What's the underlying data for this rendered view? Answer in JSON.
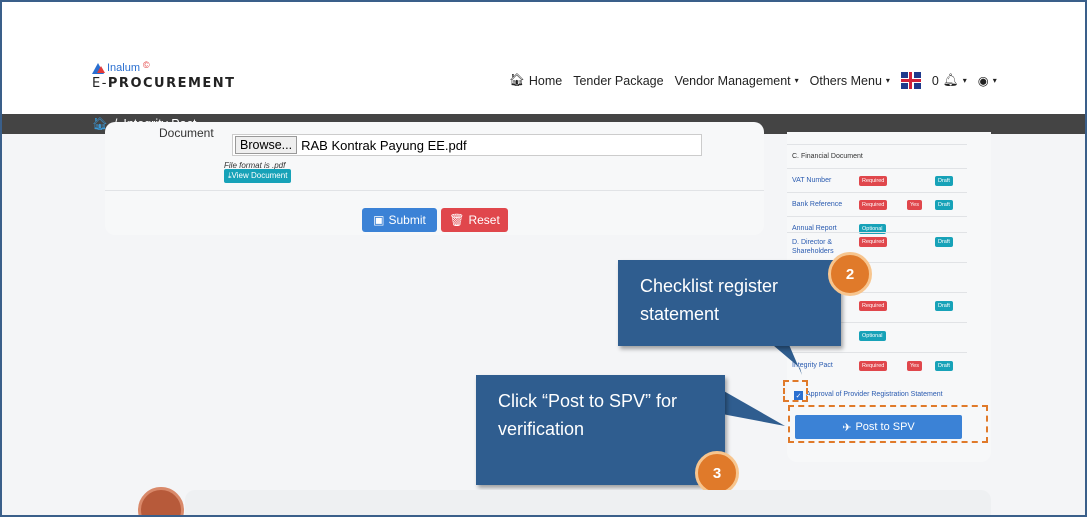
{
  "brand": {
    "logo_top": "Inalum",
    "logo_sup": "©",
    "logo_prefix": "E-",
    "logo_main": "PROCUREMENT"
  },
  "nav": {
    "home": "Home",
    "tender": "Tender Package",
    "vendor": "Vendor Management",
    "others": "Others Menu",
    "notif_count": "0"
  },
  "breadcrumb": {
    "sep": "/",
    "current": "Integrity Pact"
  },
  "form": {
    "document_label": "Document",
    "browse_label": "Browse...",
    "file_name": "RAB Kontrak Payung EE.pdf",
    "file_format": "File format is .pdf",
    "view_document": "View Document",
    "submit": "Submit",
    "reset": "Reset"
  },
  "checklist": {
    "section_c": "C. Financial Document",
    "rows": [
      {
        "label": "VAT Number",
        "status": "Required",
        "yes": "",
        "draft": "Draft"
      },
      {
        "label": "Bank Reference",
        "status": "Required",
        "yes": "Yes",
        "draft": "Draft"
      },
      {
        "label": "Annual Report",
        "status": "Optional",
        "yes": "",
        "draft": ""
      },
      {
        "label": "D. Director & Shareholders",
        "status": "Required",
        "yes": "",
        "draft": "Draft"
      },
      {
        "label": "",
        "status": "",
        "yes": "",
        "draft": ""
      },
      {
        "label": "",
        "status": "Required",
        "yes": "",
        "draft": "Draft"
      },
      {
        "label": "",
        "status": "Optional",
        "yes": "",
        "draft": ""
      },
      {
        "label": "Integrity Pact",
        "status": "Required",
        "yes": "Yes",
        "draft": "Draft"
      }
    ],
    "approval": "Approval of Provider Registration Statement",
    "post_button": "Post to SPV"
  },
  "callouts": {
    "c1_text": "Checklist register statement",
    "c1_num": "2",
    "c2_text": "Click “Post to SPV” for verification",
    "c2_num": "3"
  },
  "colors": {
    "primary": "#3b82d6",
    "danger": "#e0474c",
    "info": "#17a2b8",
    "callout": "#2f5d8f",
    "accent": "#e07a2a"
  }
}
